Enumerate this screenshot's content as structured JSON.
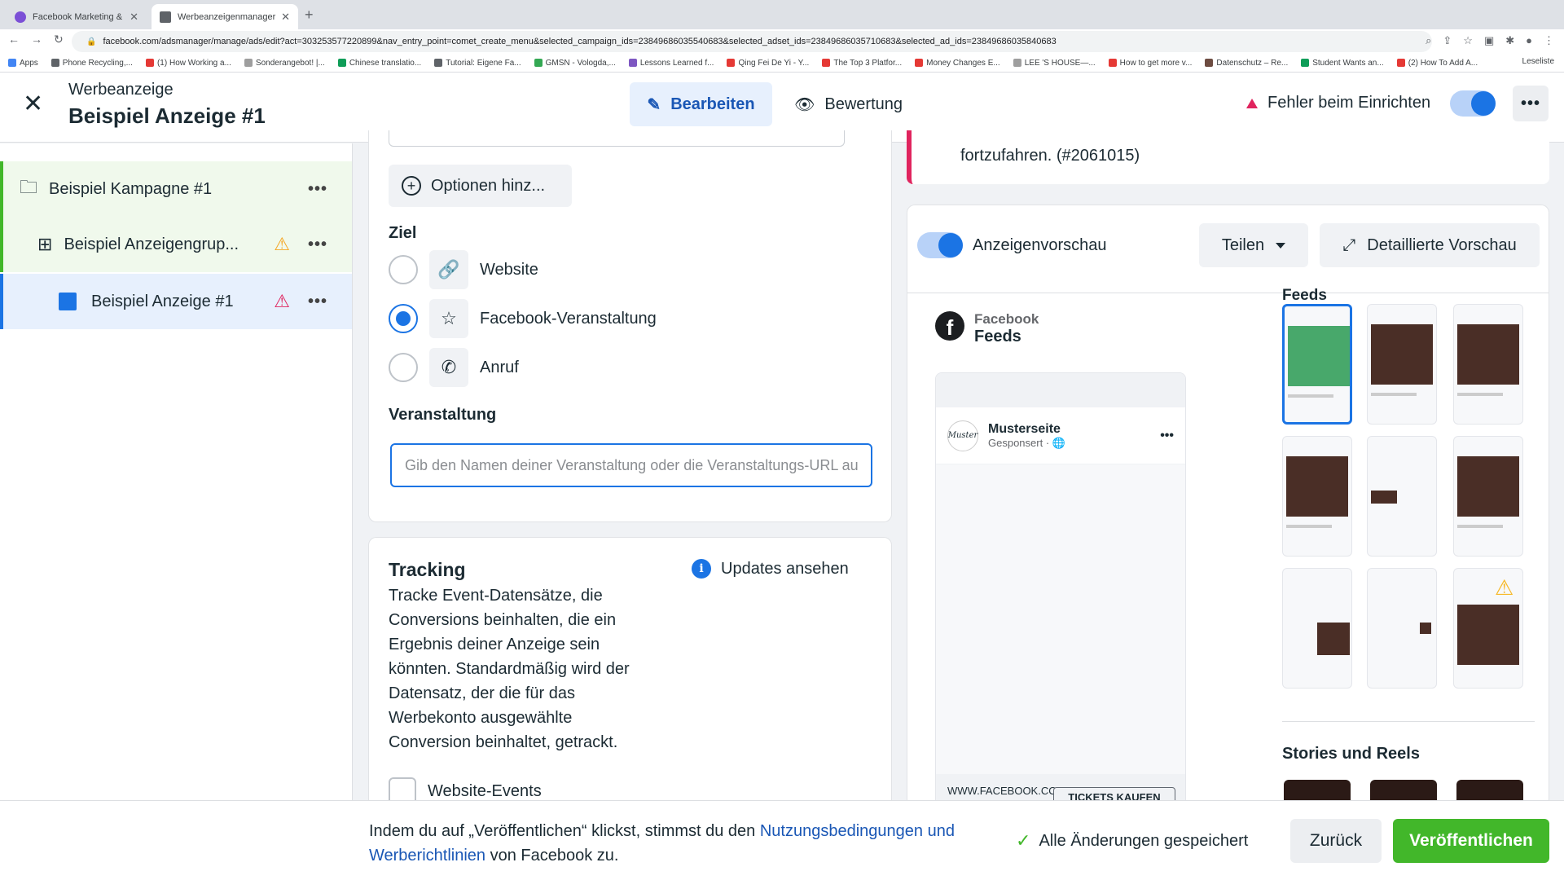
{
  "browser": {
    "tabs": [
      {
        "title": "Facebook Marketing & Werbea...",
        "active": false
      },
      {
        "title": "Werbeanzeigenmanager - Wer...",
        "active": true
      }
    ],
    "url": "facebook.com/adsmanager/manage/ads/edit?act=303253577220899&nav_entry_point=comet_create_menu&selected_campaign_ids=23849686035540683&selected_adset_ids=23849686035710683&selected_ad_ids=23849686035840683",
    "bookmarks": [
      "Apps",
      "Phone Recycling,...",
      "(1) How Working a...",
      "Sonderangebot! |...",
      "Chinese translatio...",
      "Tutorial: Eigene Fa...",
      "GMSN - Vologda,...",
      "Lessons Learned f...",
      "Qing Fei De Yi - Y...",
      "The Top 3 Platfor...",
      "Money Changes E...",
      "LEE 'S HOUSE—...",
      "How to get more v...",
      "Datenschutz – Re...",
      "Student Wants an...",
      "(2) How To Add A..."
    ],
    "reading_list": "Leseliste"
  },
  "header": {
    "subtitle": "Werbeanzeige",
    "title": "Beispiel Anzeige #1",
    "edit_label": "Bearbeiten",
    "review_label": "Bewertung",
    "error_label": "Fehler beim Einrichten",
    "accent": "#1b74e4"
  },
  "tree": {
    "campaign": "Beispiel Kampagne #1",
    "adset": "Beispiel Anzeigengrup...",
    "ad": "Beispiel Anzeige #1"
  },
  "form": {
    "options_button": "Optionen hinz...",
    "goal_label": "Ziel",
    "goals": [
      {
        "label": "Website",
        "selected": false
      },
      {
        "label": "Facebook-Veranstaltung",
        "selected": true
      },
      {
        "label": "Anruf",
        "selected": false
      }
    ],
    "event_label": "Veranstaltung",
    "event_placeholder": "Gib den Namen deiner Veranstaltung oder die Veranstaltungs-URL auf",
    "event_value": ""
  },
  "tracking": {
    "title": "Tracking",
    "text": "Tracke Event-Datensätze, die Conversions beinhalten, die ein Ergebnis deiner Anzeige sein könnten. Standardmäßig wird der Datensatz, der die für das Werbekonto ausgewählte Conversion beinhaltet, getrackt.",
    "updates_label": "Updates ansehen",
    "website_events": "Website-Events"
  },
  "error_card": {
    "text": "fortzufahren. (#2061015)"
  },
  "preview": {
    "toggle_label": "Anzeigenvorschau",
    "share_label": "Teilen",
    "detail_label": "Detaillierte Vorschau",
    "platform": "Facebook",
    "placement": "Feeds",
    "page_name": "Musterseite",
    "sponsored": "Gesponsert · ",
    "logo_text": "Muster",
    "footer_url": "WWW.FACEBOOK.COM",
    "cta": "TICKETS KAUFEN",
    "feeds_heading": "Feeds",
    "stories_heading": "Stories und Reels"
  },
  "footer": {
    "terms_prefix": "Indem du auf „Veröffentlichen“ klickst, stimmst du den ",
    "terms_link": "Nutzungsbedingungen und Werberichtlinien",
    "terms_suffix": " von Facebook zu.",
    "saved": "Alle Änderungen gespeichert",
    "back": "Zurück",
    "publish": "Veröffentlichen",
    "publish_color": "#42b72a"
  }
}
